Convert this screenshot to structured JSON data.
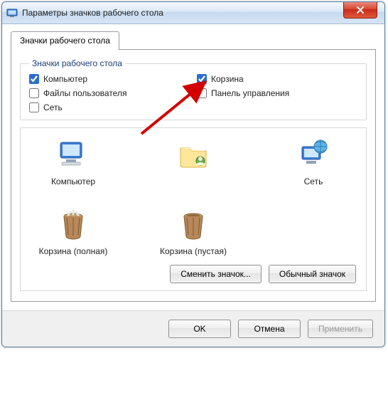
{
  "window": {
    "title": "Параметры значков рабочего стола"
  },
  "tab": {
    "label": "Значки рабочего стола"
  },
  "group": {
    "legend": "Значки рабочего стола",
    "items": [
      {
        "label": "Компьютер",
        "checked": true
      },
      {
        "label": "Корзина",
        "checked": true
      },
      {
        "label": "Файлы пользователя",
        "checked": false
      },
      {
        "label": "Панель управления",
        "checked": false
      },
      {
        "label": "Сеть",
        "checked": false
      }
    ]
  },
  "icons": [
    {
      "label": "Компьютер",
      "name": "computer-icon"
    },
    {
      "label": "Сеть",
      "name": "network-icon"
    },
    {
      "label": "Корзина (полная)",
      "name": "recycle-full-icon"
    },
    {
      "label": "Корзина (пустая)",
      "name": "recycle-empty-icon"
    }
  ],
  "buttons": {
    "change_icon": "Сменить значок...",
    "default_icon": "Обычный значок",
    "ok": "OK",
    "cancel": "Отмена",
    "apply": "Применить"
  },
  "annotation": {
    "arrow_target": "Корзина"
  }
}
